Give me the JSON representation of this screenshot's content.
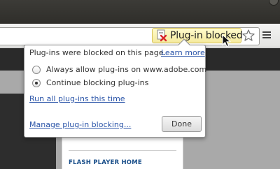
{
  "toolbar": {
    "blocked_chip_label": "Plug-in blocked",
    "icons": [
      "plugin-blocked-icon",
      "bookmark-star-icon",
      "menu-icon"
    ]
  },
  "bubble": {
    "heading": "Plug-ins were blocked on this page.",
    "learn_more": "Learn more",
    "options": [
      {
        "label": "Always allow plug-ins on www.adobe.com",
        "selected": false
      },
      {
        "label": "Continue blocking plug-ins",
        "selected": true
      }
    ],
    "run_all": "Run all plug-ins this time",
    "manage": "Manage plug-in blocking...",
    "done": "Done"
  },
  "page": {
    "card_title": "FLASH PLAYER HOME"
  },
  "colors": {
    "link": "#2a54a8",
    "chip_bg": "#f5ea9e",
    "blocked_x": "#d8262a"
  }
}
